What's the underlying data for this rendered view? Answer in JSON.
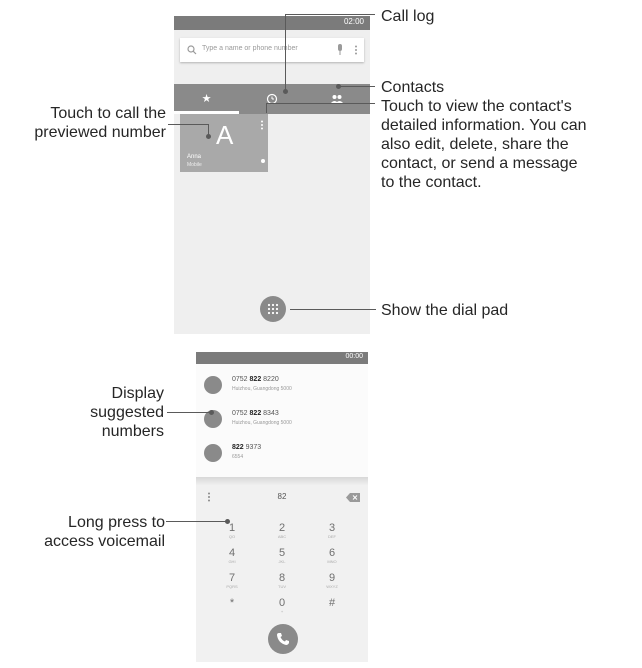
{
  "annotations": {
    "call_log": "Call log",
    "contacts": "Contacts",
    "touch_to_call_line1": "Touch to call the",
    "touch_to_call_line2": "previewed number",
    "view_info_lines": [
      "Touch to view the contact's",
      "detailed information. You can",
      "also edit, delete, share the",
      "contact, or send a message",
      "to the contact."
    ],
    "show_dial_pad": "Show the dial pad",
    "display_suggested_lines": [
      "Display",
      "suggested",
      "numbers"
    ],
    "long_press_lines": [
      "Long press to",
      "access voicemail"
    ]
  },
  "phone1": {
    "status_time": "02:00",
    "search_placeholder": "Type a name or phone number",
    "favorite": {
      "letter": "A",
      "name": "Anna",
      "type": "Mobile"
    }
  },
  "phone2": {
    "status_time": "00:00",
    "suggestions": [
      {
        "num_prefix": "0752 ",
        "num_match": "822",
        "num_rest": " 8220",
        "location": "Huizhou, Guangdong 5000"
      },
      {
        "num_prefix": "0752 ",
        "num_match": "822",
        "num_rest": " 8343",
        "location": "Huizhou, Guangdong 5000"
      },
      {
        "num_prefix": "",
        "num_match": "822",
        "num_rest": " 9373",
        "location": "6554"
      }
    ],
    "digits": "82",
    "keys": [
      {
        "digit": "1",
        "letters": "QO"
      },
      {
        "digit": "2",
        "letters": "ABC"
      },
      {
        "digit": "3",
        "letters": "DEF"
      },
      {
        "digit": "4",
        "letters": "GHI"
      },
      {
        "digit": "5",
        "letters": "JKL"
      },
      {
        "digit": "6",
        "letters": "MNO"
      },
      {
        "digit": "7",
        "letters": "PQRS"
      },
      {
        "digit": "8",
        "letters": "TUV"
      },
      {
        "digit": "9",
        "letters": "WXYZ"
      },
      {
        "digit": "*",
        "letters": ""
      },
      {
        "digit": "0",
        "letters": "+"
      },
      {
        "digit": "#",
        "letters": ""
      }
    ]
  }
}
